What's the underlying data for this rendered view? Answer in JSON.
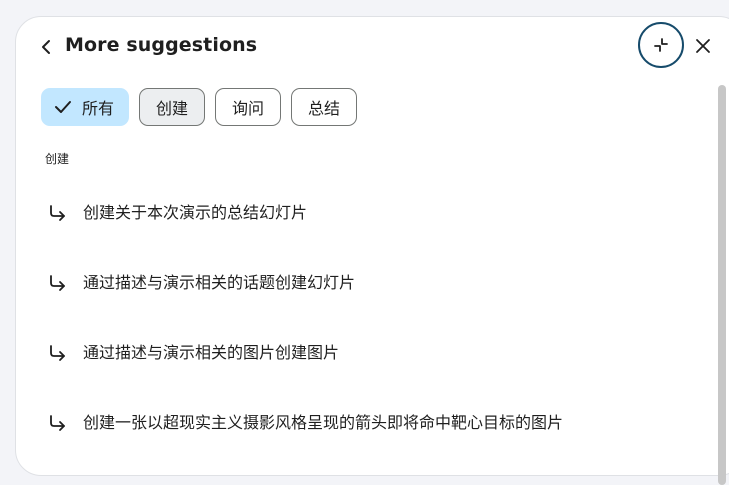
{
  "header": {
    "title": "More suggestions"
  },
  "filters": [
    {
      "label": "所有",
      "selected": true
    },
    {
      "label": "创建",
      "selected": false
    },
    {
      "label": "询问",
      "selected": false
    },
    {
      "label": "总结",
      "selected": false
    }
  ],
  "section": {
    "label": "创建"
  },
  "suggestions": [
    {
      "text": "创建关于本次演示的总结幻灯片"
    },
    {
      "text": "通过描述与演示相关的话题创建幻灯片"
    },
    {
      "text": "通过描述与演示相关的图片创建图片"
    },
    {
      "text": "创建一张以超现实主义摄影风格呈现的箭头即将命中靶心目标的图片"
    }
  ],
  "icons": {
    "back": "chevron-left-icon",
    "collapse": "collapse-icon",
    "close": "close-icon",
    "check": "check-icon",
    "suggestion": "subdirectory-arrow-icon"
  },
  "colors": {
    "selected_chip": "#c2e7ff",
    "focus_ring": "#164b6b",
    "text": "#1f1f1f"
  }
}
